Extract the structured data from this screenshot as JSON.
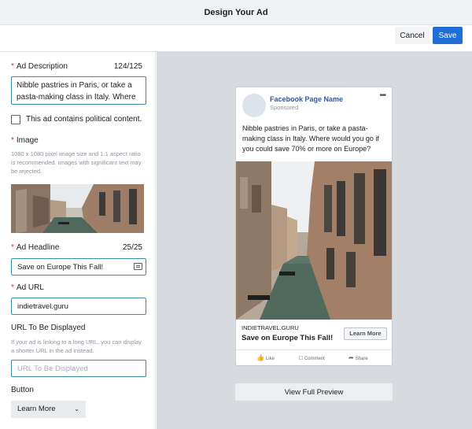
{
  "header": {
    "title": "Design Your Ad"
  },
  "toolbar": {
    "cancel_label": "Cancel",
    "save_label": "Save"
  },
  "form": {
    "description": {
      "label": "Ad Description",
      "count": "124/125",
      "value": "Nibble pastries in Paris, or take a pasta-making class in Italy. Where"
    },
    "political": {
      "label": "This ad contains political content."
    },
    "image": {
      "label": "Image",
      "help": "1080 x 1080 pixel image size and 1:1 aspect ratio is recommended. Images with significant text may be rejected."
    },
    "headline": {
      "label": "Ad Headline",
      "count": "25/25",
      "value": "Save on Europe This Fall!"
    },
    "url": {
      "label": "Ad URL",
      "value": "indietravel.guru"
    },
    "display_url": {
      "label": "URL To Be Displayed",
      "help": "If your ad is linking to a long URL, you can display a shorter URL in the ad instead.",
      "placeholder": "URL To Be Displayed"
    },
    "button": {
      "label": "Button",
      "value": "Learn More"
    }
  },
  "preview": {
    "page_name": "Facebook Page Name",
    "sponsored": "Sponsored",
    "menu": "•••",
    "text": "Nibble pastries in Paris, or take a pasta-making class in Italy. Where would you go if you could save 70% or more on Europe?",
    "url": "INDIETRAVEL.GURU",
    "headline": "Save on Europe This Fall!",
    "cta": "Learn More",
    "actions": {
      "like": "Like",
      "comment": "Comment",
      "share": "Share"
    }
  },
  "full_preview_label": "View Full Preview",
  "colors": {
    "accent": "#1f6fd6",
    "required": "#e0245e",
    "page_name": "#365899",
    "field_border": "#3b8fa6"
  },
  "icons": [
    "input-card-icon",
    "chevron-down-icon",
    "like-icon",
    "comment-icon",
    "share-icon",
    "more-icon"
  ]
}
